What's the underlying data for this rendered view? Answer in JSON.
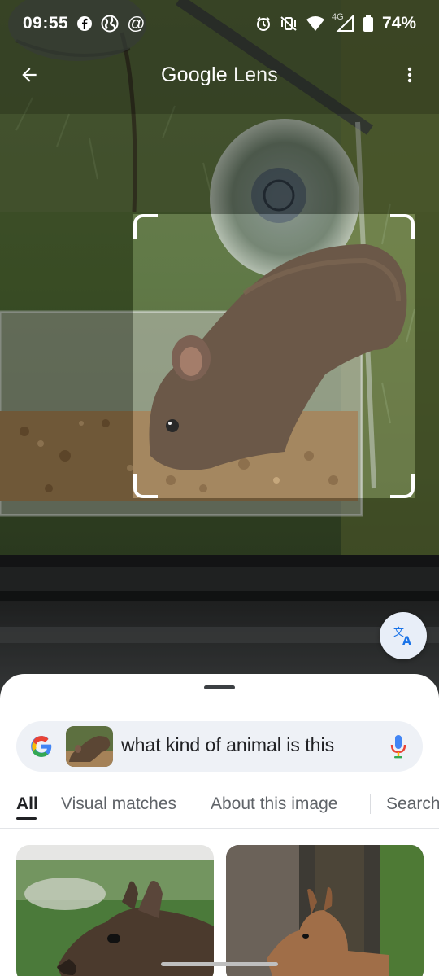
{
  "status_bar": {
    "time": "09:55",
    "left_icons": [
      "facebook-icon",
      "globe-icon",
      "at-icon"
    ],
    "right_icons": [
      "alarm-icon",
      "vibrate-off-icon",
      "wifi-icon",
      "network-4g-icon",
      "battery-icon"
    ],
    "network_label": "4G",
    "battery": "74%"
  },
  "app_bar": {
    "title_main": "Google",
    "title_sub": " Lens",
    "back_icon": "arrow-back-icon",
    "menu_icon": "more-vert-icon"
  },
  "translate_button": {
    "icon": "translate-icon"
  },
  "search": {
    "query": "what kind of animal is this",
    "logo_icon": "google-g-icon",
    "mic_icon": "mic-icon"
  },
  "tabs": [
    {
      "label": "All",
      "active": true
    },
    {
      "label": "Visual matches",
      "active": false
    },
    {
      "label": "About this image",
      "active": false
    },
    {
      "label": "Search",
      "active": false
    }
  ],
  "colors": {
    "accent": "#1a73e8",
    "sheet_bg": "#ffffff",
    "search_bg": "#eef1f6",
    "text_primary": "#202124",
    "text_secondary": "#5f6368"
  }
}
